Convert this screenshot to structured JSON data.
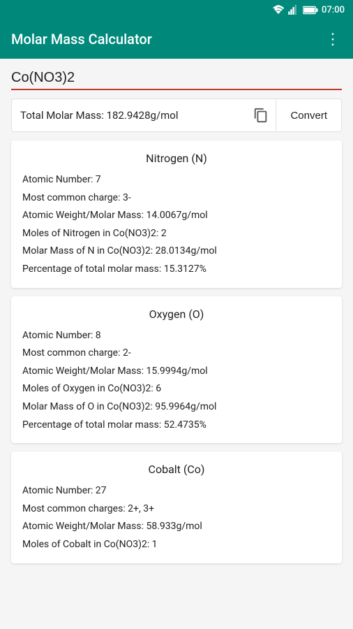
{
  "statusBar": {
    "time": "07:00"
  },
  "appBar": {
    "title": "Molar Mass Calculator",
    "menuLabel": "⋮"
  },
  "input": {
    "value": "Co(NO3)2",
    "placeholder": ""
  },
  "result": {
    "label": "Total Molar Mass: 182.9428g/mol",
    "convertLabel": "Convert"
  },
  "elements": [
    {
      "title": "Nitrogen (N)",
      "rows": [
        "Atomic Number: 7",
        "Most common charge: 3-",
        "Atomic Weight/Molar Mass: 14.0067g/mol",
        "Moles of Nitrogen in Co(NO3)2: 2",
        "Molar Mass of N in Co(NO3)2: 28.0134g/mol",
        "Percentage of total molar mass: 15.3127%"
      ]
    },
    {
      "title": "Oxygen (O)",
      "rows": [
        "Atomic Number: 8",
        "Most common charge: 2-",
        "Atomic Weight/Molar Mass: 15.9994g/mol",
        "Moles of Oxygen in Co(NO3)2: 6",
        "Molar Mass of O in Co(NO3)2: 95.9964g/mol",
        "Percentage of total molar mass: 52.4735%"
      ]
    },
    {
      "title": "Cobalt (Co)",
      "rows": [
        "Atomic Number: 27",
        "Most common charges: 2+, 3+",
        "Atomic Weight/Molar Mass: 58.933g/mol",
        "Moles of Cobalt in Co(NO3)2: 1"
      ]
    }
  ]
}
